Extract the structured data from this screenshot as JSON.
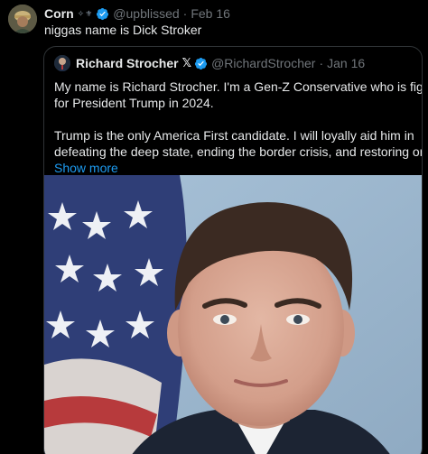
{
  "post": {
    "author": {
      "display_name": "Corn",
      "name_emoji": "✧⚜",
      "handle": "@upblissed",
      "date": "Feb 16",
      "verified": true
    },
    "separator": "·",
    "text": "niggas name is Dick Stroker"
  },
  "quoted_post": {
    "author": {
      "display_name": "Richard Strocher",
      "badge": "𝕏",
      "handle": "@RichardStrocher",
      "date": "Jan 16",
      "verified": true
    },
    "separator": "·",
    "lines_p1": [
      "My name is Richard Strocher. I'm a Gen-Z Conservative who is fighting",
      "for President Trump in 2024."
    ],
    "lines_p2": [
      "Trump is the only America First candidate. I will loyally aid him in",
      "defeating the deep state, ending the border crisis, and restoring order"
    ],
    "show_more": "Show more"
  },
  "colors": {
    "background": "#000000",
    "text": "#e7e9ea",
    "muted": "#71767b",
    "accent": "#1d9bf0",
    "border": "#2f3336"
  },
  "icons": {
    "verified": "verified-badge-icon",
    "x_logo": "x-logo-icon"
  }
}
